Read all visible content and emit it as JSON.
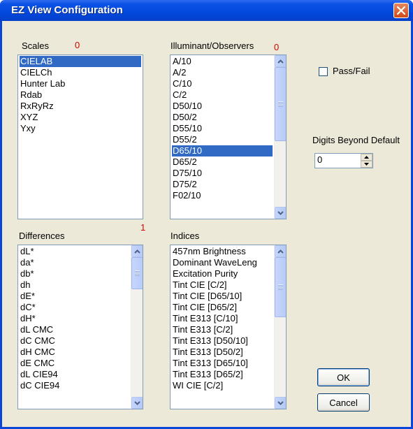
{
  "window": {
    "title": "EZ View Configuration"
  },
  "scales": {
    "label": "Scales",
    "count": "0",
    "items": [
      "CIELAB",
      "CIELCh",
      "Hunter Lab",
      "Rdab",
      "RxRyRz",
      "XYZ",
      "Yxy"
    ],
    "selected_index": 0
  },
  "illuminants": {
    "label": "Illuminant/Observers",
    "count": "0",
    "items": [
      "A/10",
      "A/2",
      "C/10",
      "C/2",
      "D50/10",
      "D50/2",
      "D55/10",
      "D55/2",
      "D65/10",
      "D65/2",
      "D75/10",
      "D75/2",
      "F02/10"
    ],
    "selected_index": 8
  },
  "differences": {
    "label": "Differences",
    "count": "1",
    "items": [
      "dL*",
      "da*",
      "db*",
      "dh",
      "dE*",
      "dC*",
      "dH*",
      "dL CMC",
      "dC CMC",
      "dH CMC",
      "dE CMC",
      "dL CIE94",
      "dC CIE94"
    ]
  },
  "indices": {
    "label": "Indices",
    "items": [
      "457nm Brightness",
      "Dominant WaveLeng",
      "Excitation Purity",
      "Tint CIE [C/2]",
      "Tint CIE [D65/10]",
      "Tint CIE [D65/2]",
      "Tint E313 [C/10]",
      "Tint E313 [C/2]",
      "Tint E313 [D50/10]",
      "Tint E313 [D50/2]",
      "Tint E313 [D65/10]",
      "Tint E313 [D65/2]",
      "WI CIE [C/2]"
    ]
  },
  "pass_fail": {
    "label": "Pass/Fail",
    "checked": false
  },
  "digits": {
    "label": "Digits Beyond Default",
    "value": "0"
  },
  "buttons": {
    "ok": "OK",
    "cancel": "Cancel"
  },
  "colors": {
    "title_bar": "#0348dd",
    "selection": "#316ac5",
    "count_red": "#d00000",
    "dialog_bg": "#ece9d8"
  }
}
